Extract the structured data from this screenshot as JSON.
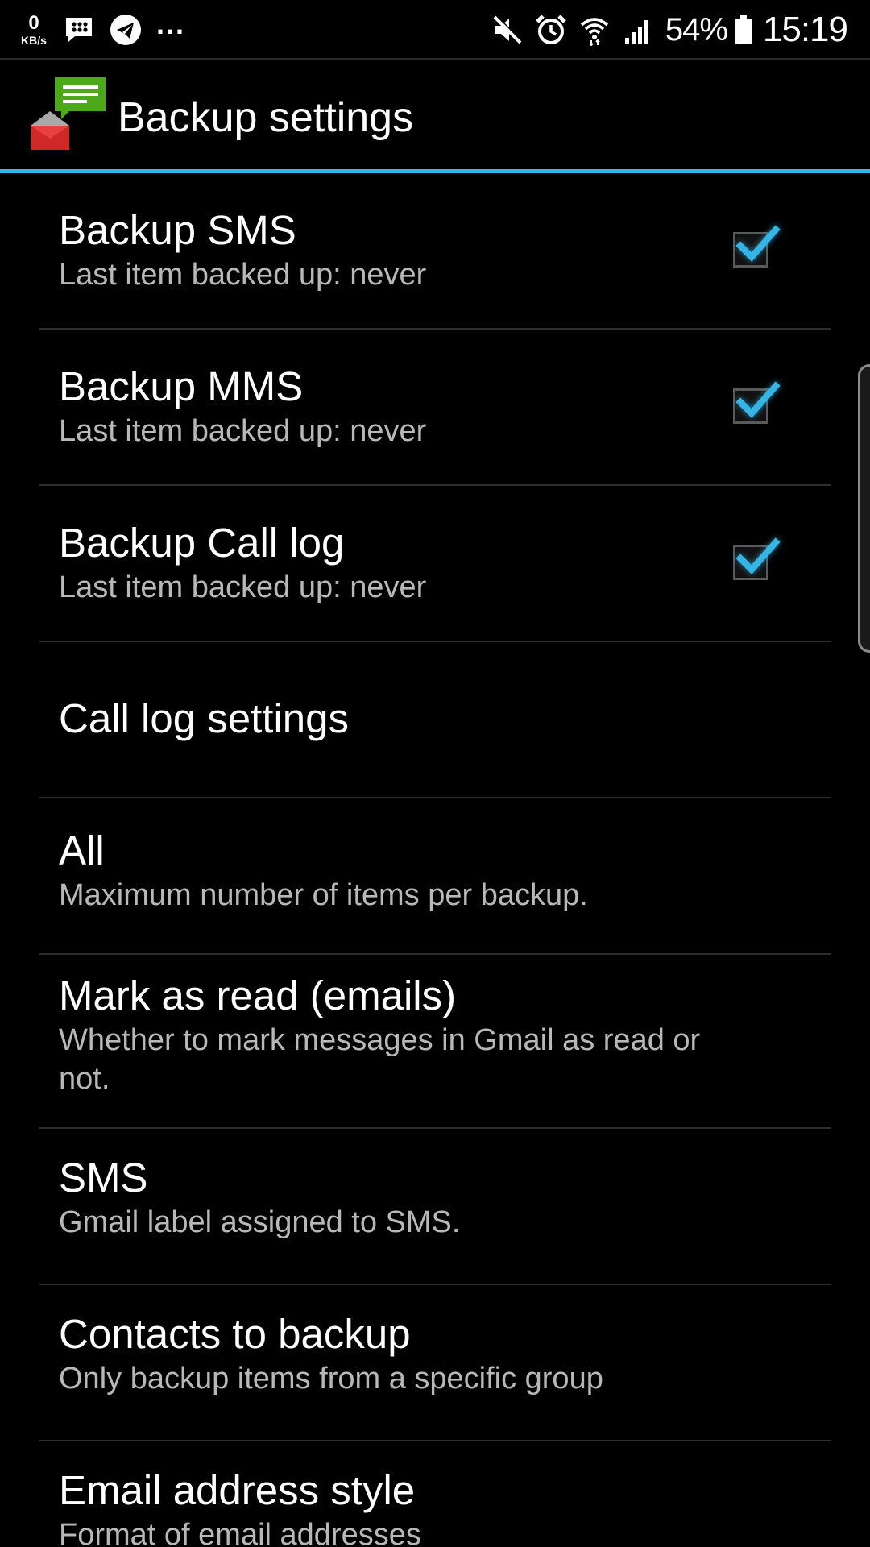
{
  "status_bar": {
    "net_speed_value": "0",
    "net_speed_unit": "KB/s",
    "more_indicator": "...",
    "battery_percent": "54%",
    "time": "15:19"
  },
  "action_bar": {
    "title": "Backup settings"
  },
  "colors": {
    "accent": "#33b5e5",
    "background": "#000000",
    "summary_text": "#b8b8b8",
    "divider": "#2e2e2e"
  },
  "preferences": [
    {
      "title": "Backup SMS",
      "summary": "Last item backed up: never",
      "checked": true
    },
    {
      "title": "Backup MMS",
      "summary": "Last item backed up: never",
      "checked": true
    },
    {
      "title": "Backup Call log",
      "summary": "Last item backed up: never",
      "checked": true
    },
    {
      "title": "Call log settings",
      "summary": ""
    },
    {
      "title": "All",
      "summary": "Maximum number of items per backup."
    },
    {
      "title": "Mark as read (emails)",
      "summary": "Whether to mark messages in Gmail as read or not."
    },
    {
      "title": "SMS",
      "summary": "Gmail label assigned to SMS."
    },
    {
      "title": "Contacts to backup",
      "summary": "Only backup items from a specific group"
    },
    {
      "title": "Email address style",
      "summary": "Format of email addresses"
    }
  ]
}
